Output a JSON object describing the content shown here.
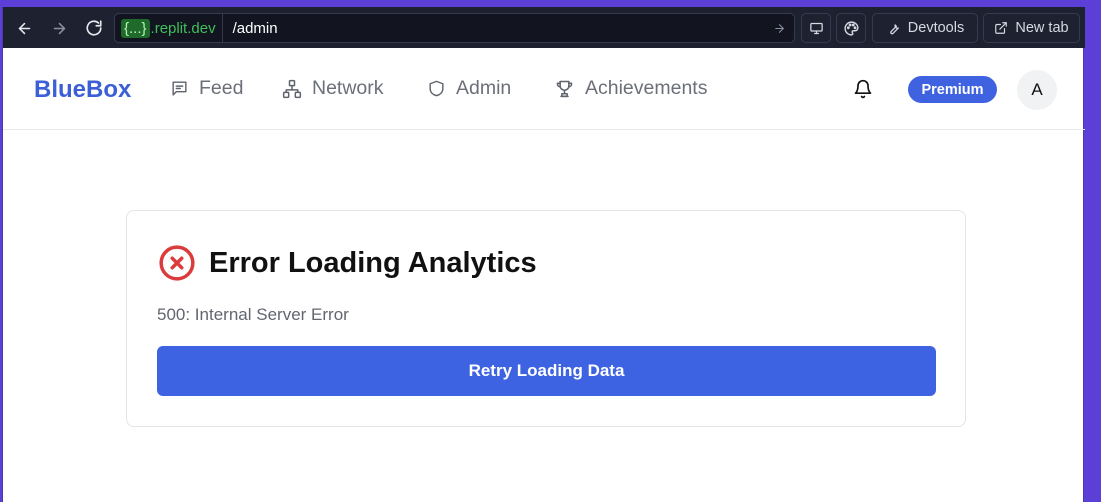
{
  "browser": {
    "domain_braces": "{...}",
    "domain_suffix": ".replit.dev",
    "path": "/admin",
    "devtools_label": "Devtools",
    "newtab_label": "New tab"
  },
  "header": {
    "brand": "BlueBox",
    "nav": [
      {
        "label": "Feed",
        "icon": "message-square-icon"
      },
      {
        "label": "Network",
        "icon": "network-icon"
      },
      {
        "label": "Admin",
        "icon": "shield-icon"
      },
      {
        "label": "Achievements",
        "icon": "trophy-icon"
      }
    ],
    "premium_label": "Premium",
    "avatar_initial": "A"
  },
  "error_card": {
    "title": "Error Loading Analytics",
    "message": "500: Internal Server Error",
    "retry_label": "Retry Loading Data"
  },
  "colors": {
    "accent": "#3e63e2",
    "brand": "#3d5fd6",
    "error": "#dc3b3b",
    "browser_bg": "#1e2230"
  }
}
